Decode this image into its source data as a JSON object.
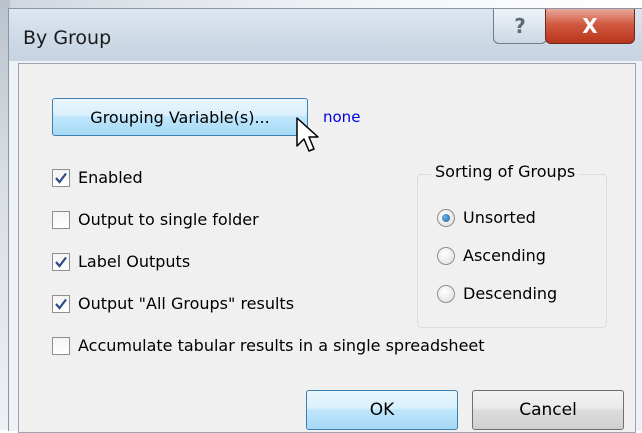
{
  "dialog": {
    "title": "By Group",
    "help_glyph": "?",
    "close_glyph": "X"
  },
  "grouping": {
    "button_label": "Grouping Variable(s)...",
    "value": "none"
  },
  "options": [
    {
      "label": "Enabled",
      "checked": true
    },
    {
      "label": "Output to single folder",
      "checked": false
    },
    {
      "label": "Label Outputs",
      "checked": true
    },
    {
      "label": "Output \"All Groups\" results",
      "checked": true
    },
    {
      "label": "Accumulate tabular results in a single spreadsheet",
      "checked": false
    }
  ],
  "sorting": {
    "legend": "Sorting of Groups",
    "options": [
      {
        "label": "Unsorted",
        "selected": true
      },
      {
        "label": "Ascending",
        "selected": false
      },
      {
        "label": "Descending",
        "selected": false
      }
    ]
  },
  "buttons": {
    "ok": "OK",
    "cancel": "Cancel"
  },
  "colors": {
    "link_blue": "#0000e0",
    "close_red": "#c8472e",
    "focus_blue": "#3c7fb1"
  }
}
